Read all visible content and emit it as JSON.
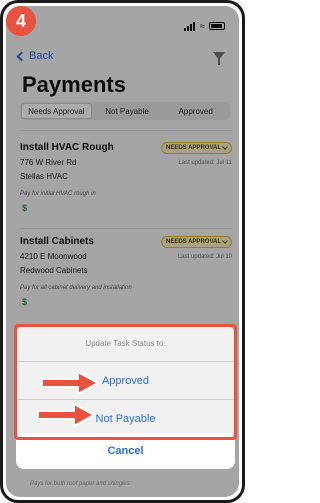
{
  "step": "4",
  "nav": {
    "back_label": "Back"
  },
  "page": {
    "title": "Payments"
  },
  "tabs": [
    {
      "label": "Needs Approval",
      "active": true
    },
    {
      "label": "Not Payable",
      "active": false
    },
    {
      "label": "Approved",
      "active": false
    }
  ],
  "tasks": [
    {
      "title": "Install HVAC Rough",
      "address": "776 W River Rd",
      "vendor": "Stellas HVAC",
      "status_badge": "NEEDS APPROVAL",
      "updated": "Last updated: Jul 11",
      "note": "Pay for initial HVAC rough in",
      "amount_icon": "$"
    },
    {
      "title": "Install Cabinets",
      "address": "4210 E Moonwood",
      "vendor": "Redwood Cabinets",
      "status_badge": "NEEDS APPROVAL",
      "updated": "Last updated: Jul 10",
      "note": "Pay for all cabinet delivery and installation",
      "amount_icon": "$"
    }
  ],
  "action_sheet": {
    "title": "Update Task Status to:",
    "options": [
      "Approved",
      "Not Payable"
    ],
    "cancel_label": "Cancel"
  },
  "bottom_note": "Pays for both roof paper and shingles",
  "colors": {
    "accent": "#2f6fdd",
    "highlight": "#e8533f",
    "badge_bg": "#fbf3c6",
    "money": "#2e9b4b"
  }
}
